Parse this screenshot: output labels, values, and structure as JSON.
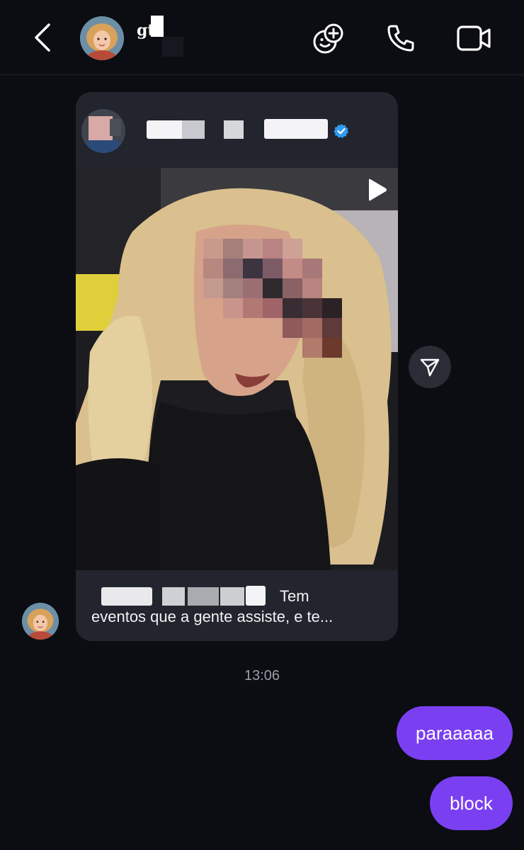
{
  "header": {
    "contact_name": "gt",
    "icons": [
      "back-icon",
      "add-effect-icon",
      "phone-icon",
      "video-icon"
    ]
  },
  "shared_post": {
    "author_verified": true,
    "media_type": "video",
    "caption_line1_end": "Tem",
    "caption_line2": "eventos que a gente assiste, e te..."
  },
  "messages": {
    "timestamp": "13:06",
    "outgoing": [
      "paraaaaa",
      "block"
    ]
  },
  "colors": {
    "background": "#0b0d12",
    "card": "#22252d",
    "outgoing_bubble": "#7b3ff2",
    "verified": "#2f9bf4",
    "timestamp": "#9a9ea8"
  }
}
